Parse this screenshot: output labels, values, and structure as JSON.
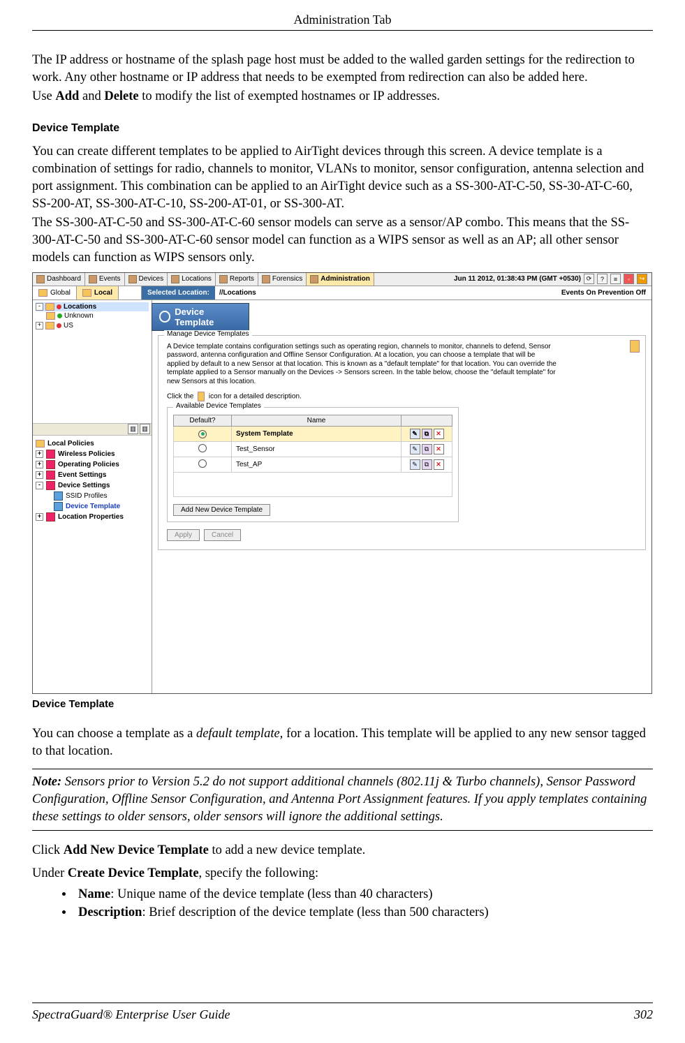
{
  "header": {
    "title": "Administration Tab"
  },
  "intro": {
    "p1": "The IP address or hostname of the splash page host must be added to the walled garden settings for the redirection to work. Any other hostname or IP address that needs to be exempted from redirection can also be added here.",
    "p2_a": "Use ",
    "p2_b1": "Add",
    "p2_c": " and ",
    "p2_b2": "Delete",
    "p2_d": " to modify the list of exempted hostnames or IP addresses."
  },
  "section": {
    "device_template_heading": "Device Template",
    "p1": "You can create different templates to be applied to AirTight devices through this screen.  A device template is a combination of settings for radio, channels to monitor, VLANs to monitor, sensor configuration, antenna selection and port assignment. This combination can be applied to an AirTight device such as a SS-300-AT-C-50, SS-30-AT-C-60, SS-200-AT, SS-300-AT-C-10, SS-200-AT-01, or SS-300-AT.",
    "p2": "The SS-300-AT-C-50 and SS-300-AT-C-60 sensor models can serve as a sensor/AP combo. This means that the SS-300-AT-C-50 and SS-300-AT-C-60 sensor model can function as a WIPS sensor as well as an AP; all other sensor models can function as WIPS sensors only."
  },
  "screenshot": {
    "tabs": [
      "Dashboard",
      "Events",
      "Devices",
      "Locations",
      "Reports",
      "Forensics",
      "Administration"
    ],
    "selected_tab": "Administration",
    "status_time": "Jun 11 2012, 01:38:43 PM (GMT +0530)",
    "global_local": {
      "global": "Global",
      "local": "Local"
    },
    "selected_location_label": "Selected Location:",
    "selected_location_path": "//Locations",
    "events_prevention": "Events On Prevention Off",
    "left_tree": {
      "root": "Locations",
      "nodes": [
        "Unknown",
        "US"
      ]
    },
    "local_policies": {
      "heading": "Local Policies",
      "items": [
        "Wireless Policies",
        "Operating Policies",
        "Event Settings",
        "Device Settings"
      ],
      "sub_items": [
        "SSID Profiles",
        "Device Template"
      ],
      "after": "Location Properties"
    },
    "panel": {
      "title": "Device Template",
      "group_legend": "Manage Device Templates",
      "desc": "A Device template contains configuration settings such as operating region, channels to monitor, channels to defend, Sensor password, antenna configuration and Offline Sensor Configuration. At a location, you can choose a template that will be applied by default to a new Sensor at that location. This is known as a \"default template\" for that location. You can override the template applied to a Sensor manually on the Devices -> Sensors screen. In the table below, choose the \"default template\" for new Sensors at this location.",
      "desc2_pre": "Click the",
      "desc2_post": "icon for a detailed description.",
      "sub_legend": "Available Device Templates",
      "columns": [
        "Default?",
        "Name",
        ""
      ],
      "rows": [
        {
          "default": true,
          "name": "System Template",
          "highlight": true
        },
        {
          "default": false,
          "name": "Test_Sensor",
          "highlight": false
        },
        {
          "default": false,
          "name": "Test_AP",
          "highlight": false
        }
      ],
      "add_button": "Add New Device Template",
      "apply": "Apply",
      "cancel": "Cancel"
    }
  },
  "caption": "Device Template",
  "after": {
    "p1_a": "You can choose a template as a ",
    "p1_i": "default template,",
    "p1_b": " for a  location. This template will be applied to any new sensor tagged to that location.",
    "note_b": "Note:",
    "note_t": " Sensors prior to Version 5.2 do not support additional channels (802.11j & Turbo channels), Sensor Password Configuration, Offline Sensor Configuration, and Antenna Port Assignment features. If you apply templates containing these settings to older sensors, older sensors will ignore the additional settings.",
    "click_a": " Click ",
    "click_b": "Add New Device Template",
    "click_c": " to add a new device template.",
    "under_a": "Under ",
    "under_b": "Create Device Template",
    "under_c": ", specify the following:",
    "bullets": [
      {
        "b": "Name",
        "t": ": Unique name of the device template (less than 40 characters)"
      },
      {
        "b": "Description",
        "t": ": Brief description of the device template (less than 500 characters)"
      }
    ]
  },
  "footer": {
    "left": "SpectraGuard®  Enterprise User Guide",
    "right": "302"
  }
}
